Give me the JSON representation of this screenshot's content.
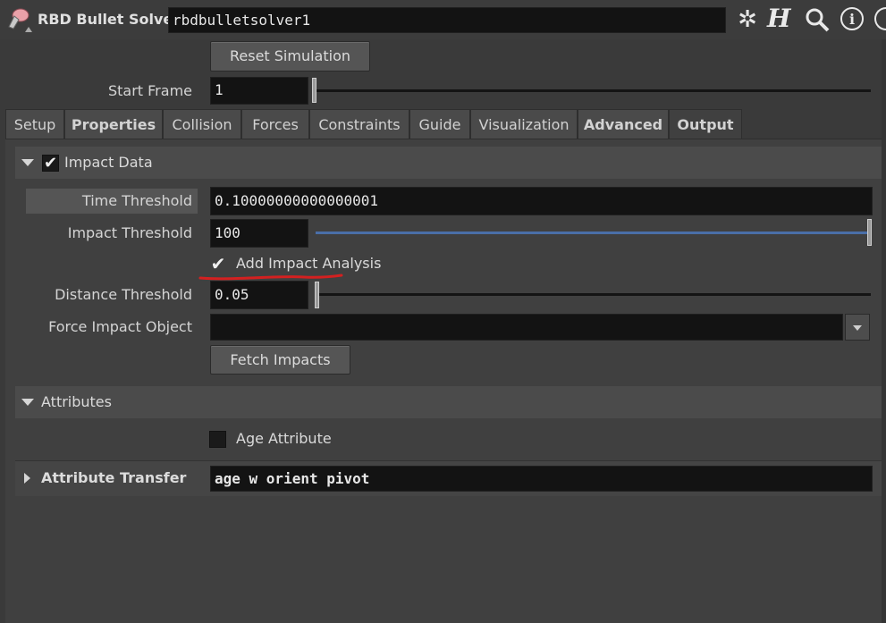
{
  "header": {
    "node_type": "RBD Bullet Solver",
    "node_name": "rbdbulletsolver1",
    "icons": [
      "rbd-node-icon",
      "gear-icon",
      "help-h-icon",
      "search-icon",
      "info-icon",
      "extra-icon"
    ]
  },
  "top": {
    "reset_button": "Reset Simulation",
    "start_frame_label": "Start Frame",
    "start_frame_value": "1"
  },
  "tabs": [
    {
      "label": "Setup"
    },
    {
      "label": "Properties"
    },
    {
      "label": "Collision"
    },
    {
      "label": "Forces"
    },
    {
      "label": "Constraints"
    },
    {
      "label": "Guide"
    },
    {
      "label": "Visualization"
    },
    {
      "label": "Advanced"
    },
    {
      "label": "Output"
    }
  ],
  "impact_data": {
    "title": "Impact Data",
    "enabled": true,
    "time_threshold_label": "Time Threshold",
    "time_threshold_value": "0.10000000000000001",
    "impact_threshold_label": "Impact Threshold",
    "impact_threshold_value": "100",
    "add_impact_analysis_label": "Add Impact Analysis",
    "add_impact_analysis_checked": true,
    "distance_threshold_label": "Distance Threshold",
    "distance_threshold_value": "0.05",
    "force_impact_object_label": "Force Impact Object",
    "force_impact_object_value": "",
    "fetch_impacts_button": "Fetch Impacts"
  },
  "attributes": {
    "title": "Attributes",
    "age_attribute_label": "Age Attribute",
    "age_attribute_checked": false,
    "attribute_transfer_label": "Attribute Transfer",
    "attribute_transfer_value": "age w orient pivot"
  },
  "colors": {
    "annotation_underline": "#d42020",
    "slider_blue": "#4a6fa8"
  }
}
